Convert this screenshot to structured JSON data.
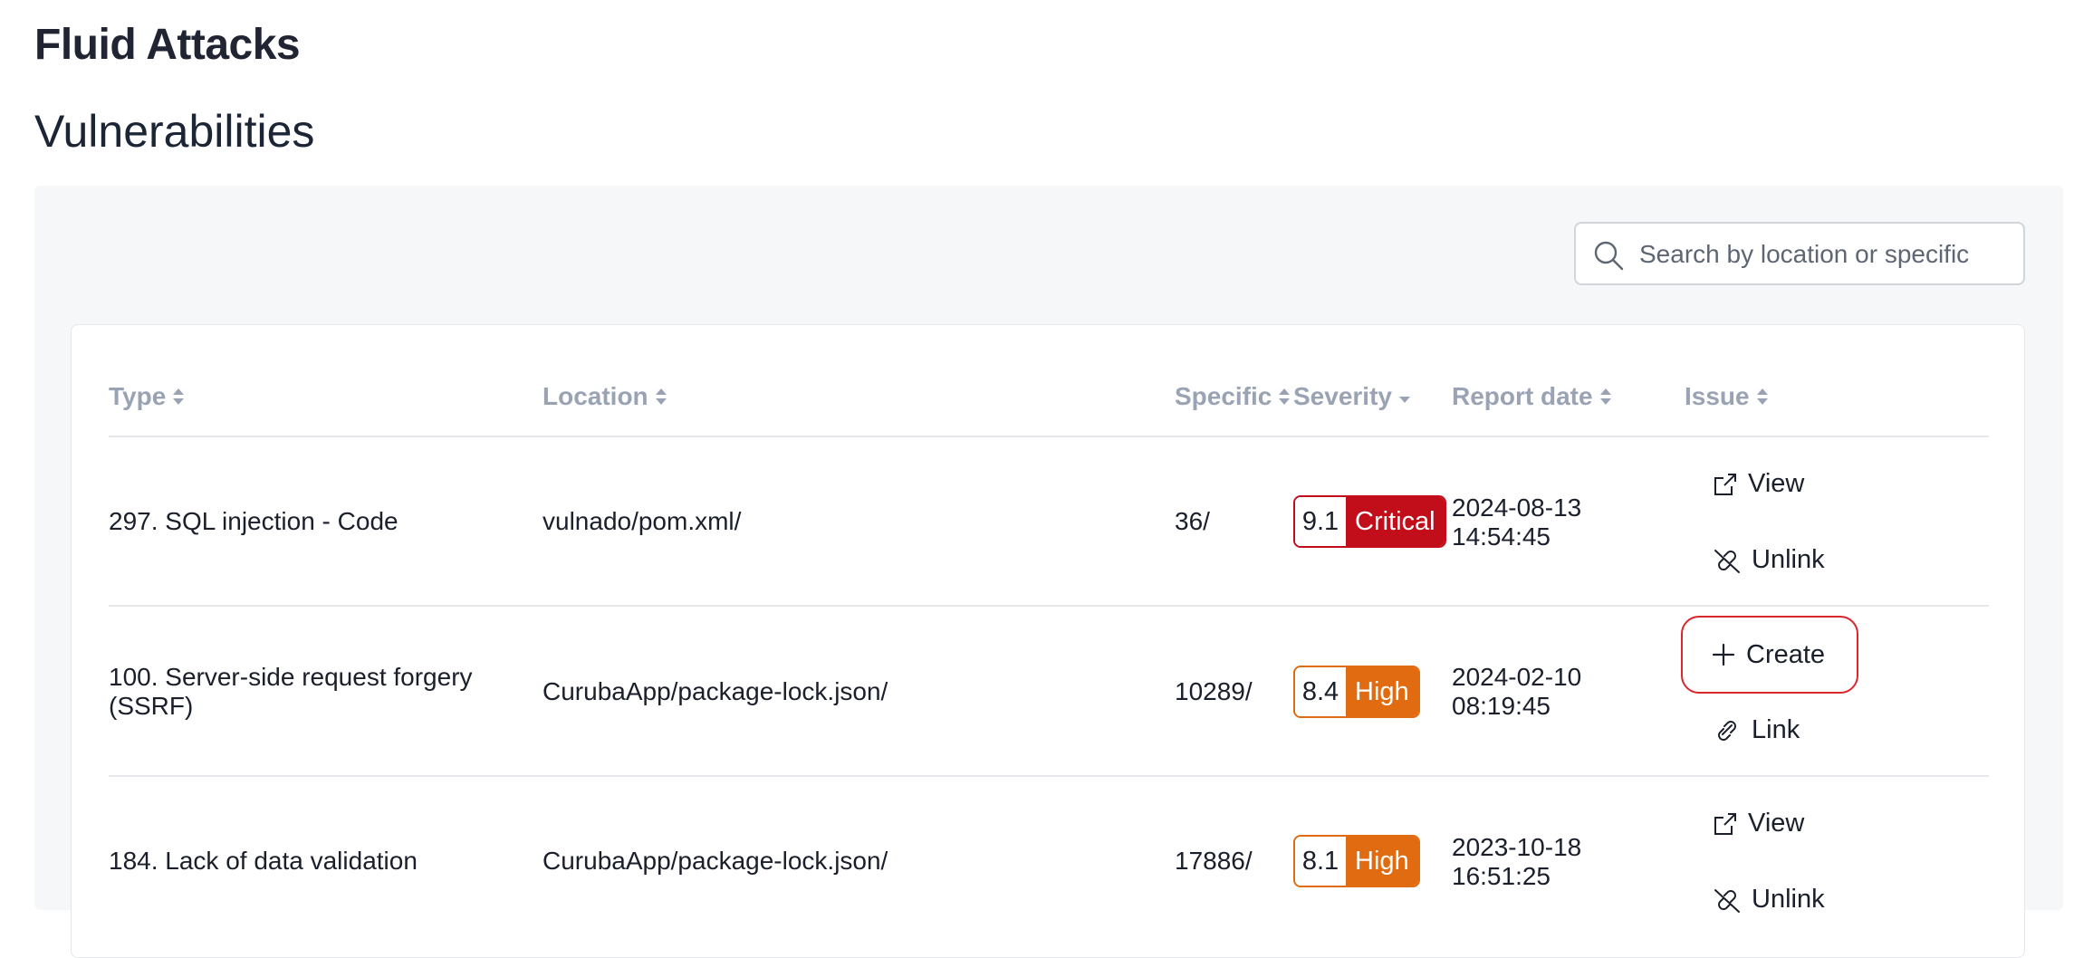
{
  "app": {
    "brand": "Fluid Attacks"
  },
  "page": {
    "title": "Vulnerabilities"
  },
  "search": {
    "placeholder": "Search by location or specific"
  },
  "table": {
    "columns": {
      "type": "Type",
      "location": "Location",
      "specific": "Specific",
      "severity": "Severity",
      "report_date": "Report date",
      "issue": "Issue"
    },
    "rows": [
      {
        "type": "297. SQL injection - Code",
        "location": "vulnado/pom.xml/",
        "specific": "36/",
        "score": "9.1",
        "severity": "Critical",
        "date": "2024-08-13",
        "time": "14:54:45",
        "actions": [
          "View",
          "Unlink"
        ]
      },
      {
        "type_line1": "100. Server-side request forgery",
        "type_line2": "(SSRF)",
        "location": "CurubaApp/package-lock.json/",
        "specific": "10289/",
        "score": "8.4",
        "severity": "High",
        "date": "2024-02-10",
        "time": "08:19:45",
        "actions": [
          "Create",
          "Link"
        ]
      },
      {
        "type": "184. Lack of data validation",
        "location": "CurubaApp/package-lock.json/",
        "specific": "17886/",
        "score": "8.1",
        "severity": "High",
        "date": "2023-10-18",
        "time": "16:51:25",
        "actions": [
          "View",
          "Unlink"
        ]
      }
    ]
  },
  "colors": {
    "critical": "#c20e1b",
    "high": "#e06b10",
    "create_border": "#d9272e",
    "header_text": "#9aa3b3"
  },
  "icons": {
    "search": "search-icon",
    "sort": "sort-icon",
    "sort_desc": "sort-desc-icon",
    "view": "external-link-icon",
    "unlink": "unlink-icon",
    "link": "link-icon",
    "create": "plus-icon"
  }
}
